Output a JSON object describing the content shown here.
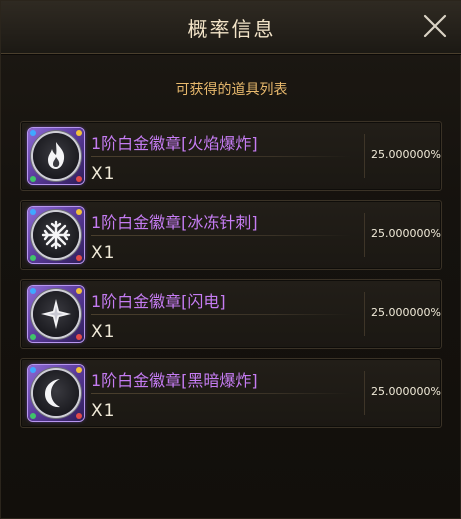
{
  "dialog": {
    "title": "概率信息",
    "subtitle": "可获得的道具列表"
  },
  "items": [
    {
      "name": "1阶白金徽章[火焰爆炸]",
      "quantity": "X1",
      "probability": "25.000000%",
      "icon": "flame-icon"
    },
    {
      "name": "1阶白金徽章[冰冻针刺]",
      "quantity": "X1",
      "probability": "25.000000%",
      "icon": "snowflake-icon"
    },
    {
      "name": "1阶白金徽章[闪电]",
      "quantity": "X1",
      "probability": "25.000000%",
      "icon": "star-icon"
    },
    {
      "name": "1阶白金徽章[黑暗爆炸]",
      "quantity": "X1",
      "probability": "25.000000%",
      "icon": "crescent-moon-icon"
    }
  ],
  "colors": {
    "title": "#f3e4c8",
    "subtitle": "#e8b96d",
    "item_name": "#c57cf2",
    "frame_purple": "#8e6bd6"
  }
}
